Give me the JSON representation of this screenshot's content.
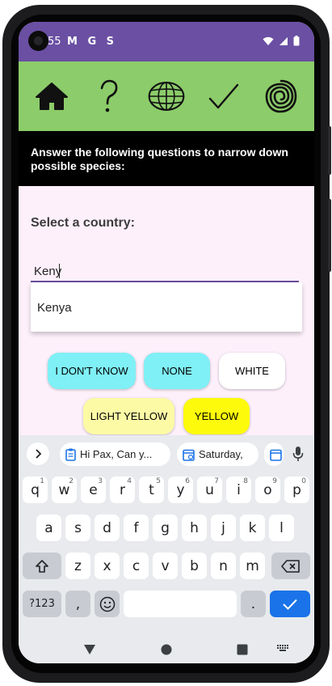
{
  "status_bar": {
    "time": "55",
    "notifications": "M G S"
  },
  "nav": {
    "items": [
      {
        "name": "home-icon"
      },
      {
        "name": "question-icon"
      },
      {
        "name": "globe-icon"
      },
      {
        "name": "check-icon"
      },
      {
        "name": "spiral-icon"
      }
    ]
  },
  "banner": {
    "text": "Answer the following questions to narrow down possible species:"
  },
  "form": {
    "question": "Select a country:",
    "input_value": "Keny",
    "suggestion": "Kenya"
  },
  "options": {
    "dont_know": "I DON'T KNOW",
    "none": "NONE",
    "white": "WHITE",
    "light_yellow": "LIGHT YELLOW",
    "yellow": "YELLOW"
  },
  "colors": {
    "status_bar": "#6a4fa3",
    "nav_bar": "#8ccc6a",
    "cyan": "#7ff0f6",
    "light_yellow": "#fdfaa6",
    "yellow": "#fdfa0b",
    "white": "#ffffff"
  },
  "keyboard": {
    "chips": [
      "Hi Pax,  Can y...",
      "Saturday,"
    ],
    "row1": [
      {
        "k": "q",
        "h": "1"
      },
      {
        "k": "w",
        "h": "2"
      },
      {
        "k": "e",
        "h": "3"
      },
      {
        "k": "r",
        "h": "4"
      },
      {
        "k": "t",
        "h": "5"
      },
      {
        "k": "y",
        "h": "6"
      },
      {
        "k": "u",
        "h": "7"
      },
      {
        "k": "i",
        "h": "8"
      },
      {
        "k": "o",
        "h": "9"
      },
      {
        "k": "p",
        "h": "0"
      }
    ],
    "row2": [
      "a",
      "s",
      "d",
      "f",
      "g",
      "h",
      "j",
      "k",
      "l"
    ],
    "row3": [
      "z",
      "x",
      "c",
      "v",
      "b",
      "n",
      "m"
    ],
    "symbols": "?123",
    "comma": ",",
    "period": "."
  }
}
